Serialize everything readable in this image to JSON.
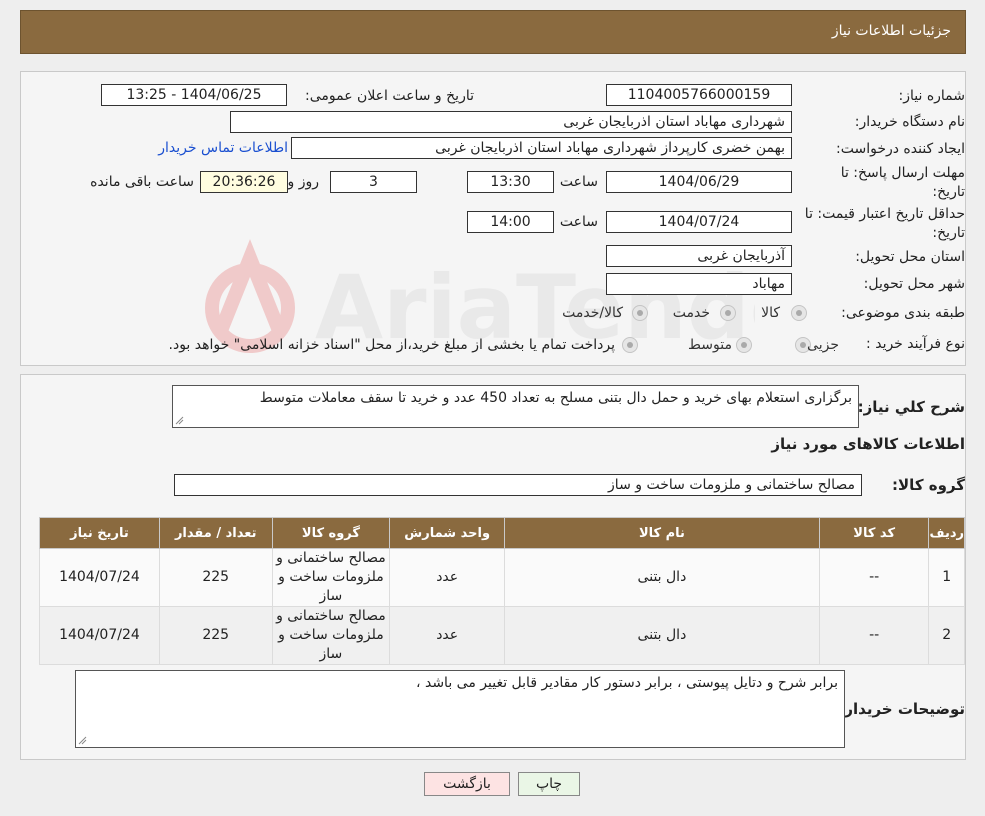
{
  "header": {
    "title": "جزئیات اطلاعات نیاز"
  },
  "form": {
    "need_number_label": "شماره نیاز:",
    "need_number": "1104005766000159",
    "announce_label": "تاریخ و ساعت اعلان عمومی:",
    "announce_value": "1404/06/25 - 13:25",
    "buyer_org_label": "نام دستگاه خریدار:",
    "buyer_org": "شهرداری مهاباد استان اذربایجان غربی",
    "creator_label": "ایجاد کننده درخواست:",
    "creator": "بهمن خضری کارپرداز شهرداری مهاباد استان اذربایجان غربی",
    "contact_link": "اطلاعات تماس خریدار",
    "deadline_label_1": "مهلت ارسال پاسخ: تا",
    "deadline_label_2": "تاریخ:",
    "deadline_date": "1404/06/29",
    "time_label": "ساعت",
    "deadline_time": "13:30",
    "days": "3",
    "days_label": "روز و",
    "remaining": "20:36:26",
    "remaining_label": "ساعت باقی مانده",
    "validity_label_1": "حداقل تاریخ اعتبار قیمت: تا",
    "validity_label_2": "تاریخ:",
    "validity_date": "1404/07/24",
    "validity_time": "14:00",
    "province_label": "استان محل تحویل:",
    "province": "آذربایجان غربی",
    "city_label": "شهر محل تحویل:",
    "city": "مهاباد",
    "category_label": "طبقه بندی موضوعی:",
    "category_options": [
      "کالا",
      "خدمت",
      "کالا/خدمت"
    ],
    "purchase_type_label": "نوع فرآیند خرید :",
    "purchase_options": [
      "جزیی",
      "متوسط"
    ],
    "purchase_note": "پرداخت تمام یا بخشی از مبلغ خرید،از محل \"اسناد خزانه اسلامی\" خواهد بود."
  },
  "summary": {
    "description_label": "شرح کلي نیاز:",
    "description": "برگزاری استعلام بهای خرید و حمل دال بتنی مسلح به تعداد 450 عدد و خرید تا سقف معاملات متوسط",
    "goods_info_title": "اطلاعات کالاهای مورد نیاز",
    "goods_group_label": "گروه کالا:",
    "goods_group": "مصالح ساختمانی و ملزومات ساخت و ساز"
  },
  "table": {
    "headers": [
      "ردیف",
      "کد کالا",
      "نام کالا",
      "واحد شمارش",
      "گروه کالا",
      "تعداد / مقدار",
      "تاریخ نیاز"
    ],
    "rows": [
      [
        "1",
        "--",
        "دال بتنی",
        "عدد",
        "مصالح ساختمانی و ملزومات ساخت و ساز",
        "225",
        "1404/07/24"
      ],
      [
        "2",
        "--",
        "دال بتنی",
        "عدد",
        "مصالح ساختمانی و ملزومات ساخت و ساز",
        "225",
        "1404/07/24"
      ]
    ]
  },
  "buyer_notes": {
    "label": "توضیحات خریدار:",
    "text": "برابر شرح و دتایل پیوستی ، برابر دستور کار مقادیر قابل تغییر می باشد ،"
  },
  "buttons": {
    "print": "چاپ",
    "back": "بازگشت"
  },
  "colors": {
    "header_bg": "#8a6a3f",
    "link": "#1a4fd0",
    "back_btn": "#fde3e3",
    "print_btn": "#eaf6e6"
  }
}
